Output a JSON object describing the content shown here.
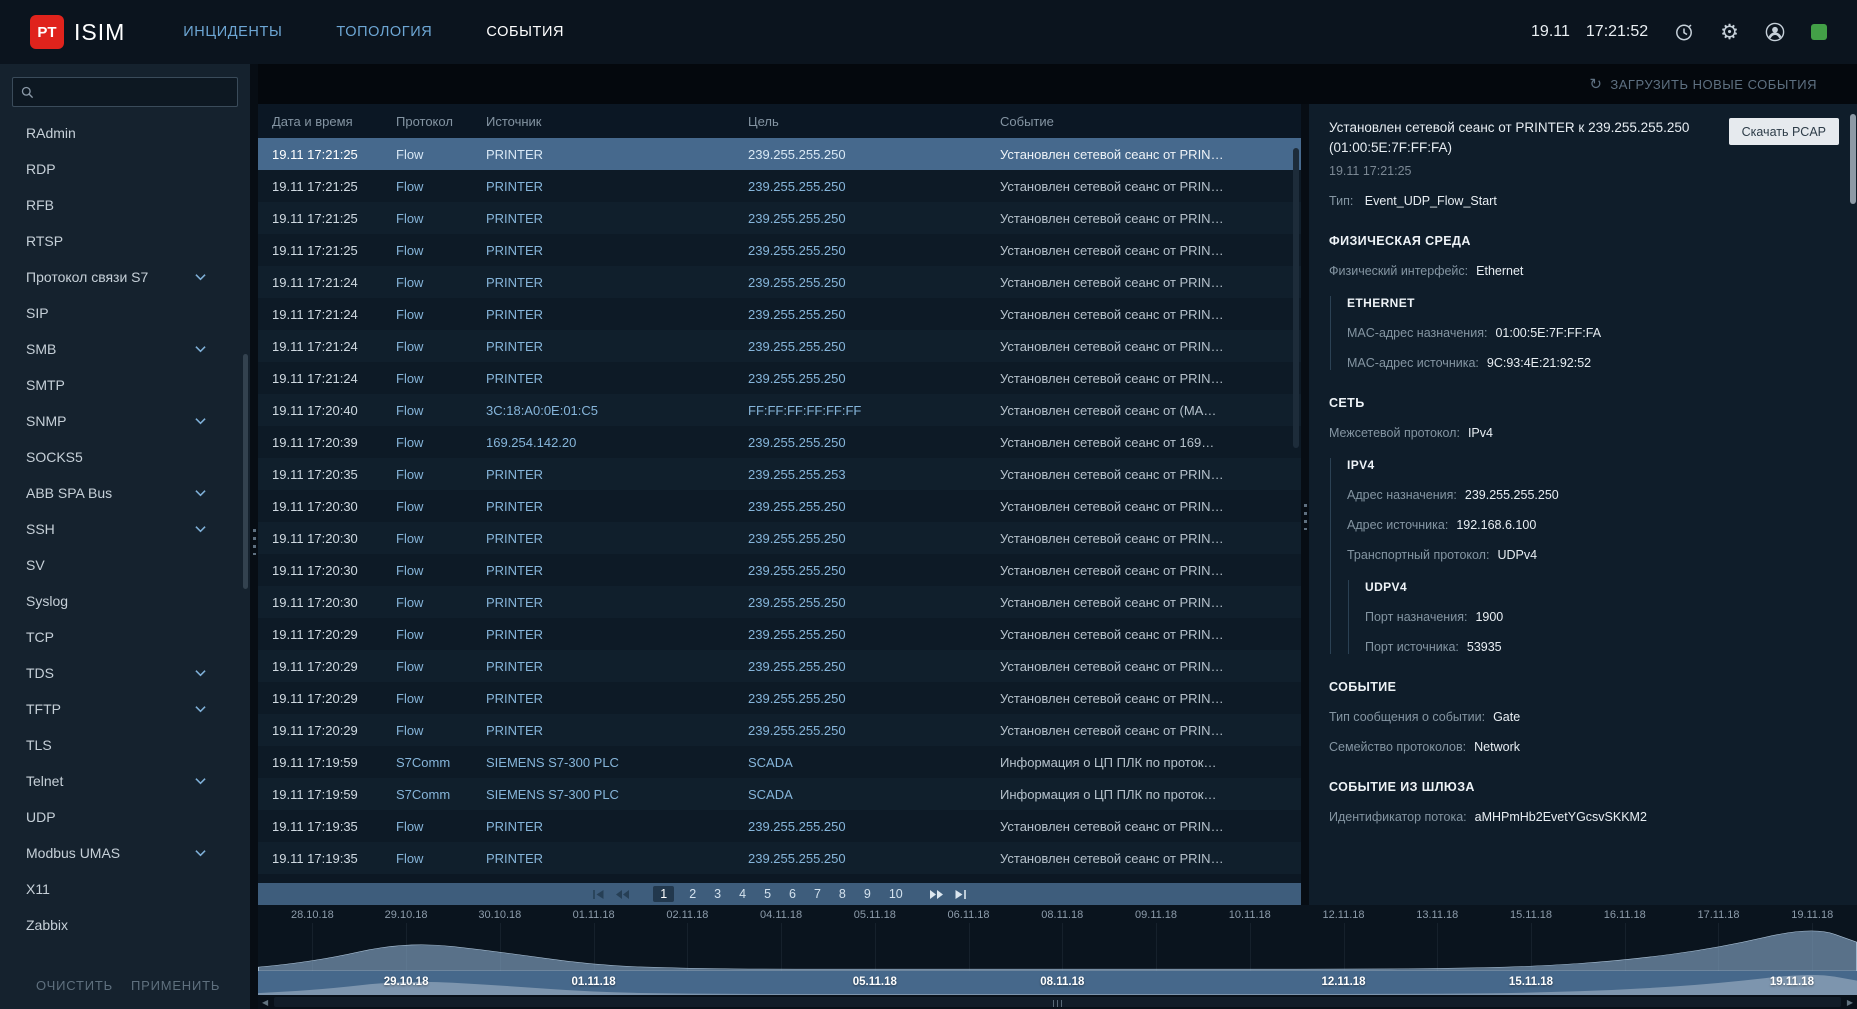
{
  "colors": {
    "brand_red": "#e0231c",
    "accent_blue": "#86b5da",
    "status_green": "#43a047",
    "selected_row": "#46698d",
    "band_blue": "#46688b",
    "pagination_blue": "#3e5d7c",
    "pcap_button_bg": "#e6eaee"
  },
  "topbar": {
    "logo_text": "PT",
    "app_name": "ISIM",
    "nav": [
      {
        "label": "ИНЦИДЕНТЫ",
        "active": false
      },
      {
        "label": "ТОПОЛОГИЯ",
        "active": false
      },
      {
        "label": "СОБЫТИЯ",
        "active": true
      }
    ],
    "date": "19.11",
    "time": "17:21:52",
    "icons": [
      "update-timer-icon",
      "settings-gear-icon",
      "user-profile-icon",
      "status-indicator"
    ]
  },
  "sidebar": {
    "search_value": "",
    "items": [
      {
        "label": "RAdmin",
        "expandable": false
      },
      {
        "label": "RDP",
        "expandable": false
      },
      {
        "label": "RFB",
        "expandable": false
      },
      {
        "label": "RTSP",
        "expandable": false
      },
      {
        "label": "Протокол связи S7",
        "expandable": true
      },
      {
        "label": "SIP",
        "expandable": false
      },
      {
        "label": "SMB",
        "expandable": true
      },
      {
        "label": "SMTP",
        "expandable": false
      },
      {
        "label": "SNMP",
        "expandable": true
      },
      {
        "label": "SOCKS5",
        "expandable": false
      },
      {
        "label": "ABB SPA Bus",
        "expandable": true
      },
      {
        "label": "SSH",
        "expandable": true
      },
      {
        "label": "SV",
        "expandable": false
      },
      {
        "label": "Syslog",
        "expandable": false
      },
      {
        "label": "TCP",
        "expandable": false
      },
      {
        "label": "TDS",
        "expandable": true
      },
      {
        "label": "TFTP",
        "expandable": true
      },
      {
        "label": "TLS",
        "expandable": false
      },
      {
        "label": "Telnet",
        "expandable": true
      },
      {
        "label": "UDP",
        "expandable": false
      },
      {
        "label": "Modbus UMAS",
        "expandable": true
      },
      {
        "label": "X11",
        "expandable": false
      },
      {
        "label": "Zabbix",
        "expandable": false
      }
    ],
    "clear_label": "ОЧИСТИТЬ",
    "apply_label": "ПРИМЕНИТЬ"
  },
  "events": {
    "load_new_label": "ЗАГРУЗИТЬ НОВЫЕ СОБЫТИЯ",
    "columns": [
      "Дата и время",
      "Протокол",
      "Источник",
      "Цель",
      "Событие"
    ],
    "rows": [
      {
        "time": "19.11 17:21:25",
        "protocol": "Flow",
        "source": "PRINTER",
        "target": "239.255.255.250",
        "event": "Установлен сетевой сеанс от PRIN…",
        "selected": true
      },
      {
        "time": "19.11 17:21:25",
        "protocol": "Flow",
        "source": "PRINTER",
        "target": "239.255.255.250",
        "event": "Установлен сетевой сеанс от PRIN…"
      },
      {
        "time": "19.11 17:21:25",
        "protocol": "Flow",
        "source": "PRINTER",
        "target": "239.255.255.250",
        "event": "Установлен сетевой сеанс от PRIN…"
      },
      {
        "time": "19.11 17:21:25",
        "protocol": "Flow",
        "source": "PRINTER",
        "target": "239.255.255.250",
        "event": "Установлен сетевой сеанс от PRIN…"
      },
      {
        "time": "19.11 17:21:24",
        "protocol": "Flow",
        "source": "PRINTER",
        "target": "239.255.255.250",
        "event": "Установлен сетевой сеанс от PRIN…"
      },
      {
        "time": "19.11 17:21:24",
        "protocol": "Flow",
        "source": "PRINTER",
        "target": "239.255.255.250",
        "event": "Установлен сетевой сеанс от PRIN…"
      },
      {
        "time": "19.11 17:21:24",
        "protocol": "Flow",
        "source": "PRINTER",
        "target": "239.255.255.250",
        "event": "Установлен сетевой сеанс от PRIN…"
      },
      {
        "time": "19.11 17:21:24",
        "protocol": "Flow",
        "source": "PRINTER",
        "target": "239.255.255.250",
        "event": "Установлен сетевой сеанс от PRIN…"
      },
      {
        "time": "19.11 17:20:40",
        "protocol": "Flow",
        "source": "3C:18:A0:0E:01:C5",
        "target": "FF:FF:FF:FF:FF:FF",
        "event": "Установлен сетевой сеанс от (MA…"
      },
      {
        "time": "19.11 17:20:39",
        "protocol": "Flow",
        "source": "169.254.142.20",
        "target": "239.255.255.250",
        "event": "Установлен сетевой сеанс от 169…"
      },
      {
        "time": "19.11 17:20:35",
        "protocol": "Flow",
        "source": "PRINTER",
        "target": "239.255.255.253",
        "event": "Установлен сетевой сеанс от PRIN…"
      },
      {
        "time": "19.11 17:20:30",
        "protocol": "Flow",
        "source": "PRINTER",
        "target": "239.255.255.250",
        "event": "Установлен сетевой сеанс от PRIN…"
      },
      {
        "time": "19.11 17:20:30",
        "protocol": "Flow",
        "source": "PRINTER",
        "target": "239.255.255.250",
        "event": "Установлен сетевой сеанс от PRIN…"
      },
      {
        "time": "19.11 17:20:30",
        "protocol": "Flow",
        "source": "PRINTER",
        "target": "239.255.255.250",
        "event": "Установлен сетевой сеанс от PRIN…"
      },
      {
        "time": "19.11 17:20:30",
        "protocol": "Flow",
        "source": "PRINTER",
        "target": "239.255.255.250",
        "event": "Установлен сетевой сеанс от PRIN…"
      },
      {
        "time": "19.11 17:20:29",
        "protocol": "Flow",
        "source": "PRINTER",
        "target": "239.255.255.250",
        "event": "Установлен сетевой сеанс от PRIN…"
      },
      {
        "time": "19.11 17:20:29",
        "protocol": "Flow",
        "source": "PRINTER",
        "target": "239.255.255.250",
        "event": "Установлен сетевой сеанс от PRIN…"
      },
      {
        "time": "19.11 17:20:29",
        "protocol": "Flow",
        "source": "PRINTER",
        "target": "239.255.255.250",
        "event": "Установлен сетевой сеанс от PRIN…"
      },
      {
        "time": "19.11 17:20:29",
        "protocol": "Flow",
        "source": "PRINTER",
        "target": "239.255.255.250",
        "event": "Установлен сетевой сеанс от PRIN…"
      },
      {
        "time": "19.11 17:19:59",
        "protocol": "S7Comm",
        "source": "SIEMENS S7-300 PLC",
        "target": "SCADA",
        "event": "Информация о ЦП ПЛК по проток…"
      },
      {
        "time": "19.11 17:19:59",
        "protocol": "S7Comm",
        "source": "SIEMENS S7-300 PLC",
        "target": "SCADA",
        "event": "Информация о ЦП ПЛК по проток…"
      },
      {
        "time": "19.11 17:19:35",
        "protocol": "Flow",
        "source": "PRINTER",
        "target": "239.255.255.250",
        "event": "Установлен сетевой сеанс от PRIN…"
      },
      {
        "time": "19.11 17:19:35",
        "protocol": "Flow",
        "source": "PRINTER",
        "target": "239.255.255.250",
        "event": "Установлен сетевой сеанс от PRIN…"
      }
    ],
    "pagination": {
      "pages": [
        "1",
        "2",
        "3",
        "4",
        "5",
        "6",
        "7",
        "8",
        "9",
        "10"
      ],
      "current": "1"
    }
  },
  "details": {
    "title": "Установлен сетевой сеанс от PRINTER к 239.255.255.250 (01:00:5E:7F:FF:FA)",
    "timestamp": "19.11 17:21:25",
    "pcap_button_label": "Скачать PCAP",
    "type_label": "Тип:",
    "type_value": "Event_UDP_Flow_Start",
    "sections": [
      {
        "title": "ФИЗИЧЕСКАЯ СРЕДА",
        "fields": [
          {
            "label": "Физический интерфейс:",
            "value": "Ethernet"
          }
        ],
        "subsections": [
          {
            "title": "ETHERNET",
            "fields": [
              {
                "label": "MAC-адрес назначения:",
                "value": "01:00:5E:7F:FF:FA"
              },
              {
                "label": "MAC-адрес источника:",
                "value": "9C:93:4E:21:92:52"
              }
            ]
          }
        ]
      },
      {
        "title": "СЕТЬ",
        "fields": [
          {
            "label": "Межсетевой протокол:",
            "value": "IPv4"
          }
        ],
        "subsections": [
          {
            "title": "IPV4",
            "fields": [
              {
                "label": "Адрес назначения:",
                "value": "239.255.255.250"
              },
              {
                "label": "Адрес источника:",
                "value": "192.168.6.100"
              },
              {
                "label": "Транспортный протокол:",
                "value": "UDPv4"
              }
            ],
            "subsections": [
              {
                "title": "UDPV4",
                "fields": [
                  {
                    "label": "Порт назначения:",
                    "value": "1900"
                  },
                  {
                    "label": "Порт источника:",
                    "value": "53935"
                  }
                ]
              }
            ]
          }
        ]
      },
      {
        "title": "СОБЫТИЕ",
        "fields": [
          {
            "label": "Тип сообщения о событии:",
            "value": "Gate"
          },
          {
            "label": "Семейство протоколов:",
            "value": "Network"
          }
        ]
      },
      {
        "title": "СОБЫТИЕ ИЗ ШЛЮЗА",
        "fields": [
          {
            "label": "Идентификатор потока:",
            "value": "aMHPmHb2EvetYGcsvSKKM2"
          }
        ]
      }
    ]
  },
  "timeline": {
    "ticks": [
      "28.10.18",
      "29.10.18",
      "30.10.18",
      "01.11.18",
      "02.11.18",
      "04.11.18",
      "05.11.18",
      "06.11.18",
      "08.11.18",
      "09.11.18",
      "10.11.18",
      "12.11.18",
      "13.11.18",
      "15.11.18",
      "16.11.18",
      "17.11.18",
      "19.11.18"
    ],
    "band_labels": [
      {
        "label": "29.10.18",
        "tick_index": 1
      },
      {
        "label": "01.11.18",
        "tick_index": 3
      },
      {
        "label": "05.11.18",
        "tick_index": 6
      },
      {
        "label": "08.11.18",
        "tick_index": 8
      },
      {
        "label": "12.11.18",
        "tick_index": 11
      },
      {
        "label": "15.11.18",
        "tick_index": 13
      },
      {
        "label": "19.11.18",
        "tick_index": 16
      }
    ]
  },
  "chart_data": {
    "type": "area",
    "title": "",
    "x": [
      "28.10.18",
      "29.10.18",
      "30.10.18",
      "01.11.18",
      "02.11.18",
      "04.11.18",
      "05.11.18",
      "06.11.18",
      "08.11.18",
      "09.11.18",
      "10.11.18",
      "12.11.18",
      "13.11.18",
      "15.11.18",
      "16.11.18",
      "17.11.18",
      "19.11.18"
    ],
    "values": [
      0.18,
      0.62,
      0.4,
      0.12,
      0.05,
      0.04,
      0.04,
      0.04,
      0.04,
      0.04,
      0.04,
      0.04,
      0.05,
      0.09,
      0.22,
      0.48,
      0.93
    ],
    "edge_values": [
      0.08,
      0.6
    ],
    "ylabel": "",
    "xlabel": "",
    "y_axis": "hidden, relative event volume 0-1",
    "x_range": [
      "28.10.18",
      "19.11.18"
    ],
    "legend": "none",
    "grid": "vertical ticks only"
  }
}
